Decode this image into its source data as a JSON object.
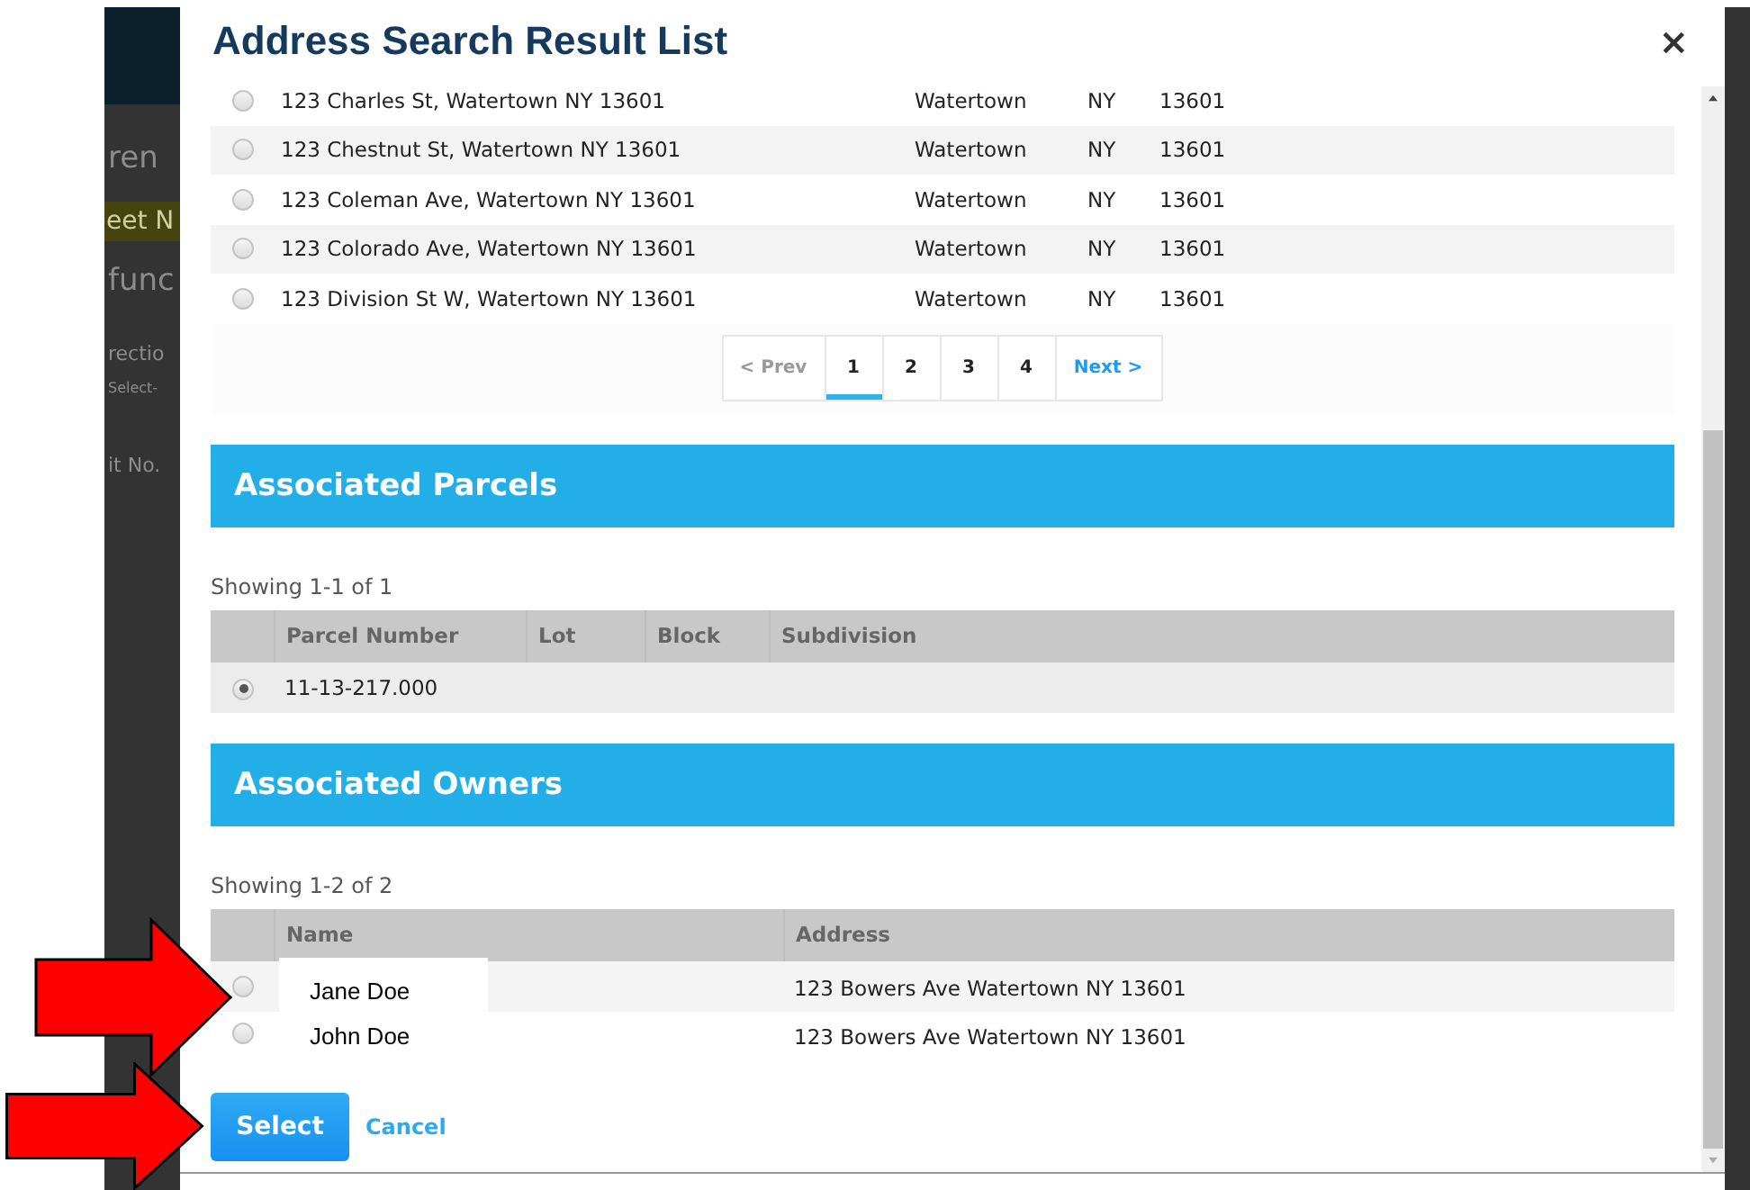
{
  "backdrop": {
    "fragments": [
      {
        "kind": "text",
        "text": "ren"
      },
      {
        "kind": "highlight",
        "text": "eet N"
      },
      {
        "kind": "text",
        "text": "func"
      },
      {
        "kind": "label",
        "text": "rectio"
      },
      {
        "kind": "small",
        "text": "Select-"
      },
      {
        "kind": "label",
        "text": "it No."
      }
    ]
  },
  "dialog": {
    "title": "Address Search Result List",
    "close": "×"
  },
  "addresses": {
    "rows": [
      {
        "selected": false,
        "address": "123 Charles St, Watertown NY 13601",
        "city": "Watertown",
        "state": "NY",
        "zip": "13601"
      },
      {
        "selected": false,
        "address": "123 Chestnut St, Watertown NY 13601",
        "city": "Watertown",
        "state": "NY",
        "zip": "13601"
      },
      {
        "selected": false,
        "address": "123 Coleman Ave, Watertown NY 13601",
        "city": "Watertown",
        "state": "NY",
        "zip": "13601"
      },
      {
        "selected": false,
        "address": "123 Colorado Ave, Watertown NY 13601",
        "city": "Watertown",
        "state": "NY",
        "zip": "13601"
      },
      {
        "selected": false,
        "address": "123 Division St W, Watertown NY 13601",
        "city": "Watertown",
        "state": "NY",
        "zip": "13601"
      }
    ],
    "pager": {
      "prev": "< Prev",
      "next": "Next >",
      "pages": [
        {
          "label": "1",
          "selected": true
        },
        {
          "label": "2",
          "selected": false
        },
        {
          "label": "3",
          "selected": false
        },
        {
          "label": "4",
          "selected": false
        }
      ]
    }
  },
  "parcels": {
    "heading": "Associated Parcels",
    "showing": "Showing 1-1 of 1",
    "columns": [
      "Parcel Number",
      "Lot",
      "Block",
      "Subdivision"
    ],
    "rows": [
      {
        "selected": true,
        "parcel_number": "11-13-217.000"
      }
    ]
  },
  "owners": {
    "heading": "Associated Owners",
    "showing": "Showing 1-2 of 2",
    "columns": [
      "Name",
      "Address"
    ],
    "rows": [
      {
        "selected": false,
        "covered": true,
        "name": "Jane Doe",
        "address": "123 Bowers Ave Watertown NY 13601"
      },
      {
        "selected": false,
        "covered": false,
        "name": "John Doe",
        "address": "123 Bowers Ave Watertown NY 13601"
      }
    ]
  },
  "buttons": {
    "select": "Select",
    "cancel": "Cancel"
  }
}
